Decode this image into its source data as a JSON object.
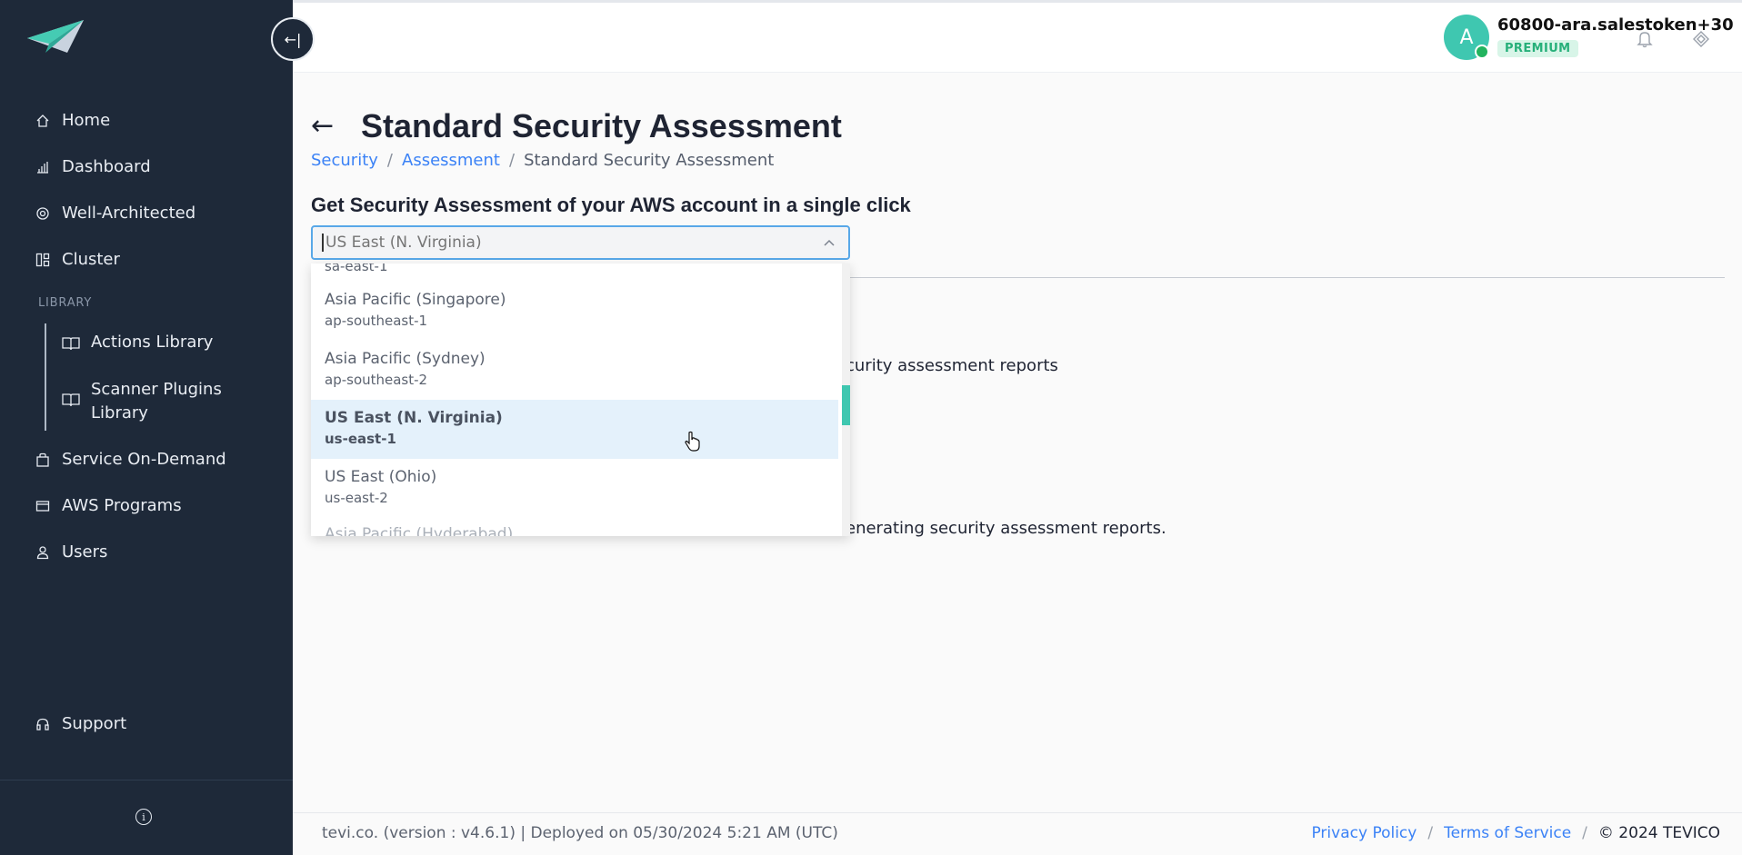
{
  "sidebar": {
    "nav": [
      {
        "label": "Home",
        "icon": "home-icon"
      },
      {
        "label": "Dashboard",
        "icon": "chart-icon"
      },
      {
        "label": "Well-Architected",
        "icon": "eye-icon"
      },
      {
        "label": "Cluster",
        "icon": "layout-icon"
      }
    ],
    "library_heading": "LIBRARY",
    "library_items": [
      {
        "label": "Actions Library",
        "icon": "book-icon"
      },
      {
        "label": "Scanner Plugins Library",
        "label_line1": "Scanner Plugins",
        "label_line2": "Library",
        "icon": "book-icon"
      }
    ],
    "nav_bottom": [
      {
        "label": "Service On-Demand",
        "icon": "bag-icon"
      },
      {
        "label": "AWS Programs",
        "icon": "card-icon"
      },
      {
        "label": "Users",
        "icon": "user-icon"
      }
    ],
    "support": {
      "label": "Support",
      "icon": "headset-icon"
    },
    "collapse_glyph": "←|"
  },
  "header": {
    "user_initial": "A",
    "user_name": "60800-ara.salestoken+30",
    "plan_badge": "PREMIUM"
  },
  "main": {
    "back_glyph": "←",
    "title": "Standard Security Assessment",
    "breadcrumb": [
      "Security",
      "Assessment",
      "Standard Security Assessment"
    ],
    "section_title": "Get Security Assessment of your AWS account in a single click",
    "region_select": {
      "value": "US East (N. Virginia)",
      "placeholder": "US East (N. Virginia)"
    },
    "bg_text_1": "curity assessment reports",
    "bg_text_2": "enerating security assessment reports."
  },
  "dropdown": {
    "partial_top": "sa-east-1",
    "options": [
      {
        "name": "Asia Pacific (Singapore)",
        "code": "ap-southeast-1",
        "selected": false
      },
      {
        "name": "Asia Pacific (Sydney)",
        "code": "ap-southeast-2",
        "selected": false
      },
      {
        "name": "US East (N. Virginia)",
        "code": "us-east-1",
        "selected": true
      },
      {
        "name": "US East (Ohio)",
        "code": "us-east-2",
        "selected": false
      }
    ],
    "partial_bottom": "Asia Pacific (Hyderabad)"
  },
  "footer": {
    "left": "tevi.co. (version : v4.6.1) | Deployed on 05/30/2024 5:21 AM (UTC)",
    "privacy": "Privacy Policy",
    "terms": "Terms of Service",
    "copyright": "© 2024 TEVICO"
  },
  "colors": {
    "sidebar_bg": "#1e2939",
    "accent": "#3fc7b0",
    "link": "#3b82f6"
  }
}
